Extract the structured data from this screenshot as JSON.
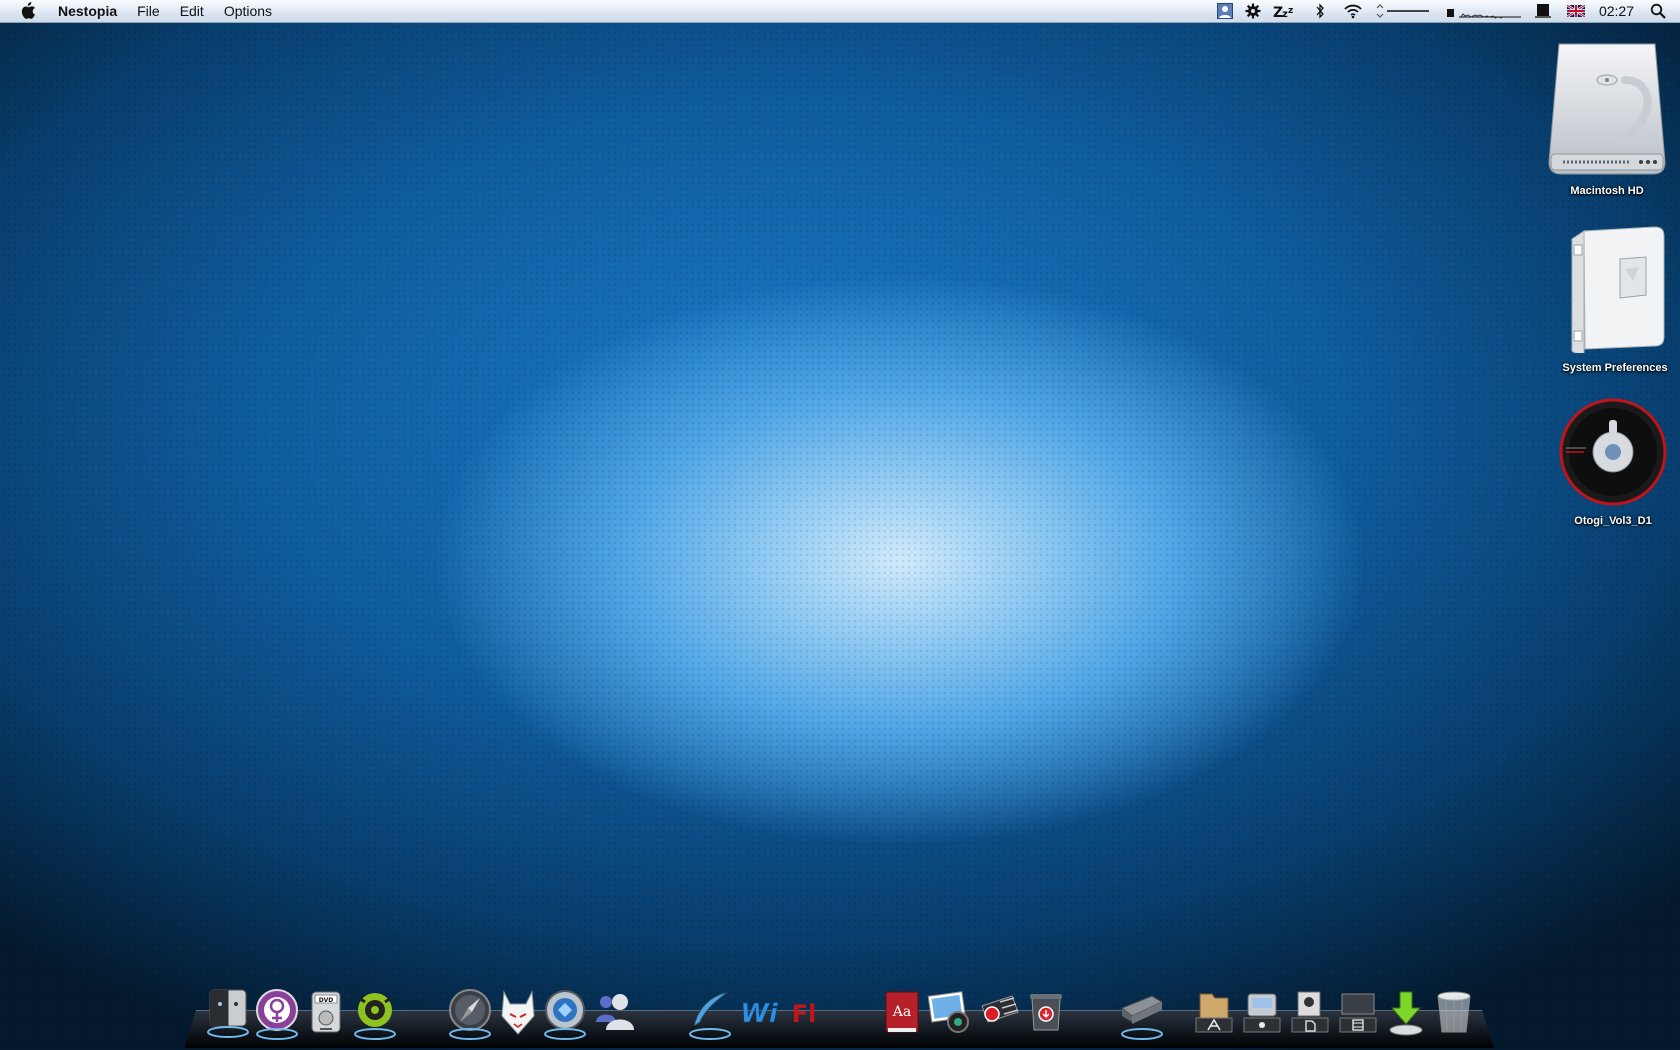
{
  "menubar": {
    "app_name": "Nestopia",
    "menus": [
      "File",
      "Edit",
      "Options"
    ],
    "clock": "02:27",
    "status_icons": [
      "user-icon",
      "gear-icon",
      "sleep-icon",
      "bluetooth-icon",
      "wifi-icon",
      "volume-icon",
      "cpu-meter-icon",
      "battery-icon",
      "uk-flag-icon",
      "spotlight-icon"
    ]
  },
  "desktop": {
    "icons": [
      {
        "label": "Macintosh HD",
        "icon": "hard-drive-icon"
      },
      {
        "label": "System Preferences",
        "icon": "system-preferences-icon"
      },
      {
        "label": "Otogi_Vol3_D1",
        "icon": "disc-icon"
      }
    ]
  },
  "dock": {
    "items": [
      {
        "name": "finder-icon",
        "label": ""
      },
      {
        "name": "itunes-icon",
        "label": ""
      },
      {
        "name": "dvd-player-icon",
        "label": "DVD"
      },
      {
        "name": "disk-utility-icon",
        "label": ""
      },
      {
        "name": "safari-icon",
        "label": ""
      },
      {
        "name": "fox-mail-icon",
        "label": ""
      },
      {
        "name": "network-icon",
        "label": ""
      },
      {
        "name": "messenger-icon",
        "label": ""
      },
      {
        "name": "quill-icon",
        "label": ""
      },
      {
        "name": "wii-icon",
        "label": "Wi"
      },
      {
        "name": "flash-icon",
        "label": "Fl"
      },
      {
        "name": "dictionary-icon",
        "label": "Aa"
      },
      {
        "name": "iphoto-icon",
        "label": ""
      },
      {
        "name": "video-recorder-icon",
        "label": ""
      },
      {
        "name": "downloads-trash-icon",
        "label": ""
      },
      {
        "name": "scanner-icon",
        "label": ""
      },
      {
        "name": "applications-folder-icon",
        "label": ""
      },
      {
        "name": "printer-folder-icon",
        "label": ""
      },
      {
        "name": "documents-folder-icon",
        "label": ""
      },
      {
        "name": "movies-folder-icon",
        "label": ""
      },
      {
        "name": "downloads-icon",
        "label": ""
      },
      {
        "name": "trash-icon",
        "label": ""
      }
    ]
  }
}
